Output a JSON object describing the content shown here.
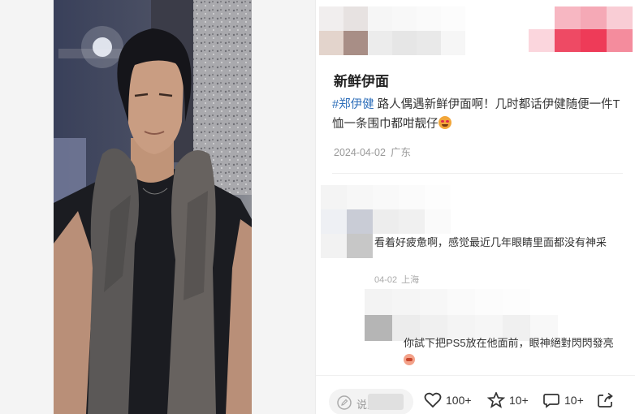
{
  "post": {
    "title": "新鲜伊面",
    "hashtag": "#郑伊健",
    "body": "路人偶遇新鲜伊面啊！几时都话伊健随便一件T恤一条围巾都咁靓仔",
    "date": "2024-04-02",
    "location": "广东"
  },
  "comments": [
    {
      "text": "看着好疲惫啊，感觉最近几年眼睛里面都没有神采",
      "date": "04-02",
      "location": "上海"
    },
    {
      "text": "你試下把PS5放在他面前，眼神絕對閃閃發亮"
    }
  ],
  "footer": {
    "comment_placeholder": "说点什么...",
    "likes": "100+",
    "favorites": "10+",
    "comments": "10+"
  },
  "colors": {
    "hashtag": "#2f6fba",
    "accent_red": "#ee3b58"
  }
}
